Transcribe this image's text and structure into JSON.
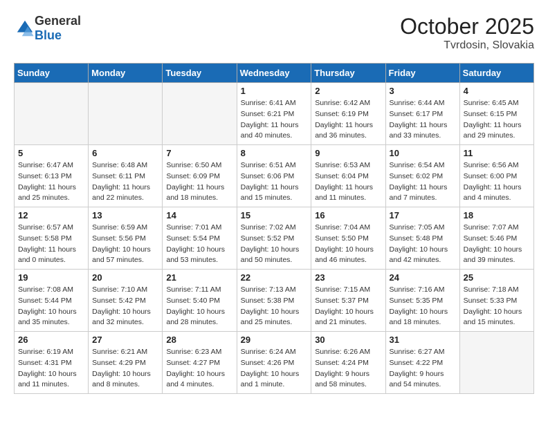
{
  "header": {
    "logo_general": "General",
    "logo_blue": "Blue",
    "month": "October 2025",
    "location": "Tvrdosin, Slovakia"
  },
  "weekdays": [
    "Sunday",
    "Monday",
    "Tuesday",
    "Wednesday",
    "Thursday",
    "Friday",
    "Saturday"
  ],
  "weeks": [
    [
      {
        "day": "",
        "info": ""
      },
      {
        "day": "",
        "info": ""
      },
      {
        "day": "",
        "info": ""
      },
      {
        "day": "1",
        "info": "Sunrise: 6:41 AM\nSunset: 6:21 PM\nDaylight: 11 hours\nand 40 minutes."
      },
      {
        "day": "2",
        "info": "Sunrise: 6:42 AM\nSunset: 6:19 PM\nDaylight: 11 hours\nand 36 minutes."
      },
      {
        "day": "3",
        "info": "Sunrise: 6:44 AM\nSunset: 6:17 PM\nDaylight: 11 hours\nand 33 minutes."
      },
      {
        "day": "4",
        "info": "Sunrise: 6:45 AM\nSunset: 6:15 PM\nDaylight: 11 hours\nand 29 minutes."
      }
    ],
    [
      {
        "day": "5",
        "info": "Sunrise: 6:47 AM\nSunset: 6:13 PM\nDaylight: 11 hours\nand 25 minutes."
      },
      {
        "day": "6",
        "info": "Sunrise: 6:48 AM\nSunset: 6:11 PM\nDaylight: 11 hours\nand 22 minutes."
      },
      {
        "day": "7",
        "info": "Sunrise: 6:50 AM\nSunset: 6:09 PM\nDaylight: 11 hours\nand 18 minutes."
      },
      {
        "day": "8",
        "info": "Sunrise: 6:51 AM\nSunset: 6:06 PM\nDaylight: 11 hours\nand 15 minutes."
      },
      {
        "day": "9",
        "info": "Sunrise: 6:53 AM\nSunset: 6:04 PM\nDaylight: 11 hours\nand 11 minutes."
      },
      {
        "day": "10",
        "info": "Sunrise: 6:54 AM\nSunset: 6:02 PM\nDaylight: 11 hours\nand 7 minutes."
      },
      {
        "day": "11",
        "info": "Sunrise: 6:56 AM\nSunset: 6:00 PM\nDaylight: 11 hours\nand 4 minutes."
      }
    ],
    [
      {
        "day": "12",
        "info": "Sunrise: 6:57 AM\nSunset: 5:58 PM\nDaylight: 11 hours\nand 0 minutes."
      },
      {
        "day": "13",
        "info": "Sunrise: 6:59 AM\nSunset: 5:56 PM\nDaylight: 10 hours\nand 57 minutes."
      },
      {
        "day": "14",
        "info": "Sunrise: 7:01 AM\nSunset: 5:54 PM\nDaylight: 10 hours\nand 53 minutes."
      },
      {
        "day": "15",
        "info": "Sunrise: 7:02 AM\nSunset: 5:52 PM\nDaylight: 10 hours\nand 50 minutes."
      },
      {
        "day": "16",
        "info": "Sunrise: 7:04 AM\nSunset: 5:50 PM\nDaylight: 10 hours\nand 46 minutes."
      },
      {
        "day": "17",
        "info": "Sunrise: 7:05 AM\nSunset: 5:48 PM\nDaylight: 10 hours\nand 42 minutes."
      },
      {
        "day": "18",
        "info": "Sunrise: 7:07 AM\nSunset: 5:46 PM\nDaylight: 10 hours\nand 39 minutes."
      }
    ],
    [
      {
        "day": "19",
        "info": "Sunrise: 7:08 AM\nSunset: 5:44 PM\nDaylight: 10 hours\nand 35 minutes."
      },
      {
        "day": "20",
        "info": "Sunrise: 7:10 AM\nSunset: 5:42 PM\nDaylight: 10 hours\nand 32 minutes."
      },
      {
        "day": "21",
        "info": "Sunrise: 7:11 AM\nSunset: 5:40 PM\nDaylight: 10 hours\nand 28 minutes."
      },
      {
        "day": "22",
        "info": "Sunrise: 7:13 AM\nSunset: 5:38 PM\nDaylight: 10 hours\nand 25 minutes."
      },
      {
        "day": "23",
        "info": "Sunrise: 7:15 AM\nSunset: 5:37 PM\nDaylight: 10 hours\nand 21 minutes."
      },
      {
        "day": "24",
        "info": "Sunrise: 7:16 AM\nSunset: 5:35 PM\nDaylight: 10 hours\nand 18 minutes."
      },
      {
        "day": "25",
        "info": "Sunrise: 7:18 AM\nSunset: 5:33 PM\nDaylight: 10 hours\nand 15 minutes."
      }
    ],
    [
      {
        "day": "26",
        "info": "Sunrise: 6:19 AM\nSunset: 4:31 PM\nDaylight: 10 hours\nand 11 minutes."
      },
      {
        "day": "27",
        "info": "Sunrise: 6:21 AM\nSunset: 4:29 PM\nDaylight: 10 hours\nand 8 minutes."
      },
      {
        "day": "28",
        "info": "Sunrise: 6:23 AM\nSunset: 4:27 PM\nDaylight: 10 hours\nand 4 minutes."
      },
      {
        "day": "29",
        "info": "Sunrise: 6:24 AM\nSunset: 4:26 PM\nDaylight: 10 hours\nand 1 minute."
      },
      {
        "day": "30",
        "info": "Sunrise: 6:26 AM\nSunset: 4:24 PM\nDaylight: 9 hours\nand 58 minutes."
      },
      {
        "day": "31",
        "info": "Sunrise: 6:27 AM\nSunset: 4:22 PM\nDaylight: 9 hours\nand 54 minutes."
      },
      {
        "day": "",
        "info": ""
      }
    ]
  ]
}
